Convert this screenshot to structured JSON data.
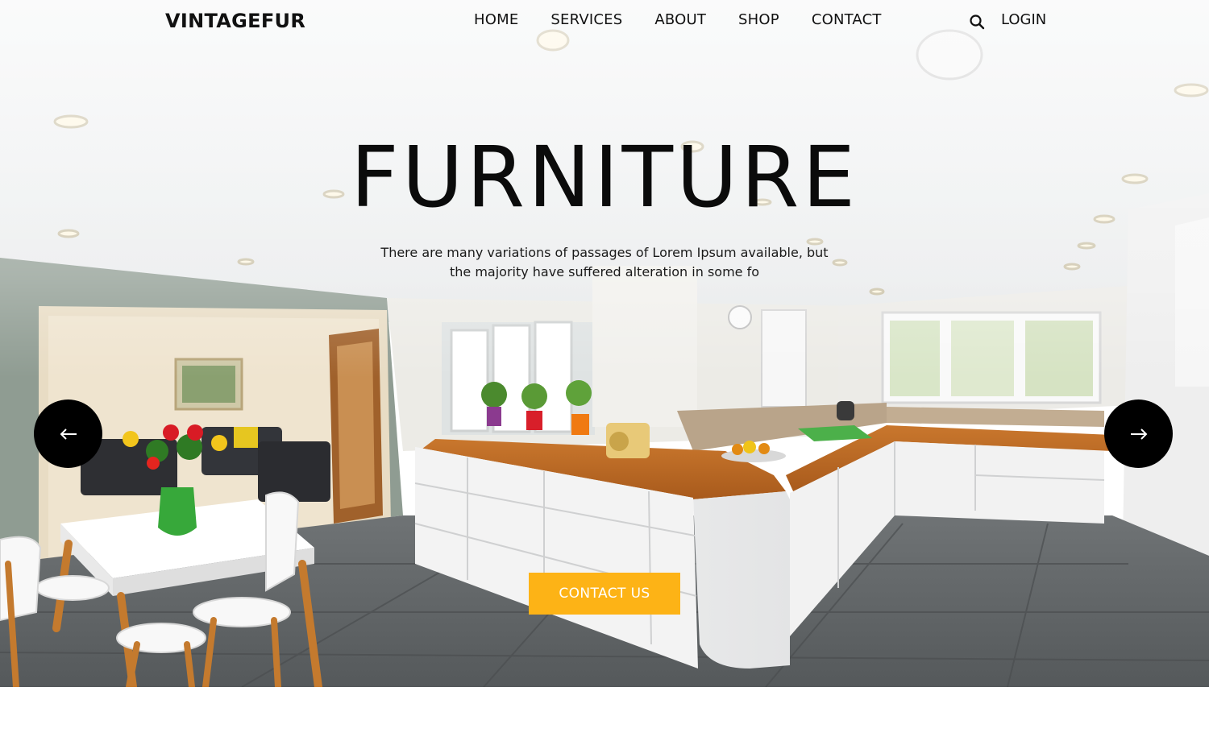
{
  "header": {
    "logo": "VINTAGEFUR",
    "nav": [
      {
        "label": "HOME"
      },
      {
        "label": "SERVICES"
      },
      {
        "label": "ABOUT"
      },
      {
        "label": "SHOP"
      },
      {
        "label": "CONTACT"
      }
    ],
    "search_icon": "search-icon",
    "login_label": "LOGIN"
  },
  "hero": {
    "title": "FURNITURE",
    "description": "There are many variations of passages of Lorem Ipsum available, but the majority have suffered alteration in some fo",
    "cta_label": "CONTACT US",
    "prev_icon": "arrow-left-icon",
    "next_icon": "arrow-right-icon",
    "background": "kitchen-dining-interior-photo"
  },
  "colors": {
    "accent": "#fdb316",
    "text": "#111111",
    "arrow_bg": "#000000"
  }
}
